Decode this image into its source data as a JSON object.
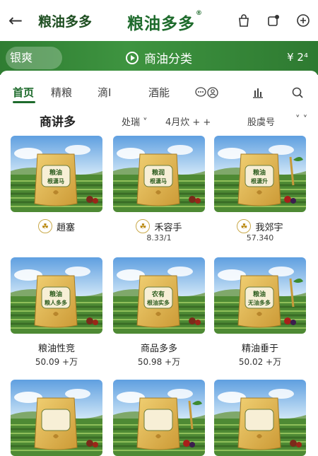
{
  "header": {
    "back_icon": "back-arrow-icon",
    "brand_left": "粮油多多",
    "brand_center": "粮油多多",
    "registered": "®",
    "icons": [
      "bag-icon",
      "share-icon",
      "add-circle-icon"
    ]
  },
  "greenbar": {
    "search_text": "银爽",
    "category_label": "商油分类",
    "right_value": "¥ 2⁴"
  },
  "tabs": {
    "items": [
      "首页",
      "精粮",
      "滴Ⅰ",
      "酒能"
    ],
    "active_index": 0,
    "icon_names": [
      "chat-user-icon",
      "chart-bars-icon",
      "search-icon"
    ]
  },
  "section": {
    "title": "商讲多",
    "sort_1": "处瑞 ˅",
    "sort_2": "4月炊 + +",
    "sort_3": "股虞号",
    "sort_4": "˅ ˅"
  },
  "products": [
    {
      "title": "趙塞",
      "price": "",
      "bag_text": "粮油\n根潇马"
    },
    {
      "title": "禾容手",
      "price": "8.33/1",
      "bag_text": "粮润\n根潇马"
    },
    {
      "title": "我郊宇",
      "price": "57.340",
      "bag_text": "粮油\n根潇升"
    },
    {
      "title": "粮油性竞",
      "price": "50.09 +万",
      "bag_text": "粮油\n粮人多多"
    },
    {
      "title": "商品多多",
      "price": "50.98 +万",
      "bag_text": "农有\n根油实多"
    },
    {
      "title": "精油垂于",
      "price": "50.02 +万",
      "bag_text": "粮油\n无油多多"
    }
  ],
  "colors": {
    "brand_green": "#1e6b2c",
    "bar_green": "#2f7d32",
    "bag_gold": "#e2b84d"
  }
}
